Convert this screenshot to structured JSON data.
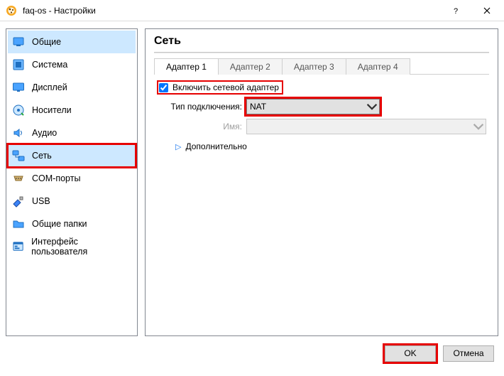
{
  "window": {
    "title": "faq-os - Настройки",
    "help_tip": "?",
    "close_tip": "×"
  },
  "sidebar": {
    "items": [
      {
        "label": "Общие",
        "icon": "general"
      },
      {
        "label": "Система",
        "icon": "system"
      },
      {
        "label": "Дисплей",
        "icon": "display"
      },
      {
        "label": "Носители",
        "icon": "storage"
      },
      {
        "label": "Аудио",
        "icon": "audio"
      },
      {
        "label": "Сеть",
        "icon": "network"
      },
      {
        "label": "COM-порты",
        "icon": "serial"
      },
      {
        "label": "USB",
        "icon": "usb"
      },
      {
        "label": "Общие папки",
        "icon": "folder"
      },
      {
        "label": "Интерфейс пользователя",
        "icon": "ui"
      }
    ],
    "selected_index": 5
  },
  "main": {
    "title": "Сеть",
    "tabs": [
      {
        "label": "Адаптер 1"
      },
      {
        "label": "Адаптер 2"
      },
      {
        "label": "Адаптер 3"
      },
      {
        "label": "Адаптер 4"
      }
    ],
    "active_tab": 0,
    "enable_adapter_label": "Включить сетевой адаптер",
    "enable_adapter_checked": true,
    "attachment_label": "Тип подключения:",
    "attachment_value": "NAT",
    "name_label": "Имя:",
    "name_value": "",
    "advanced_label": "Дополнительно"
  },
  "footer": {
    "ok": "OK",
    "cancel": "Отмена"
  },
  "highlights": {
    "sidebar_network": true,
    "enable_checkbox": true,
    "attachment_combo": true,
    "ok_button": true
  }
}
